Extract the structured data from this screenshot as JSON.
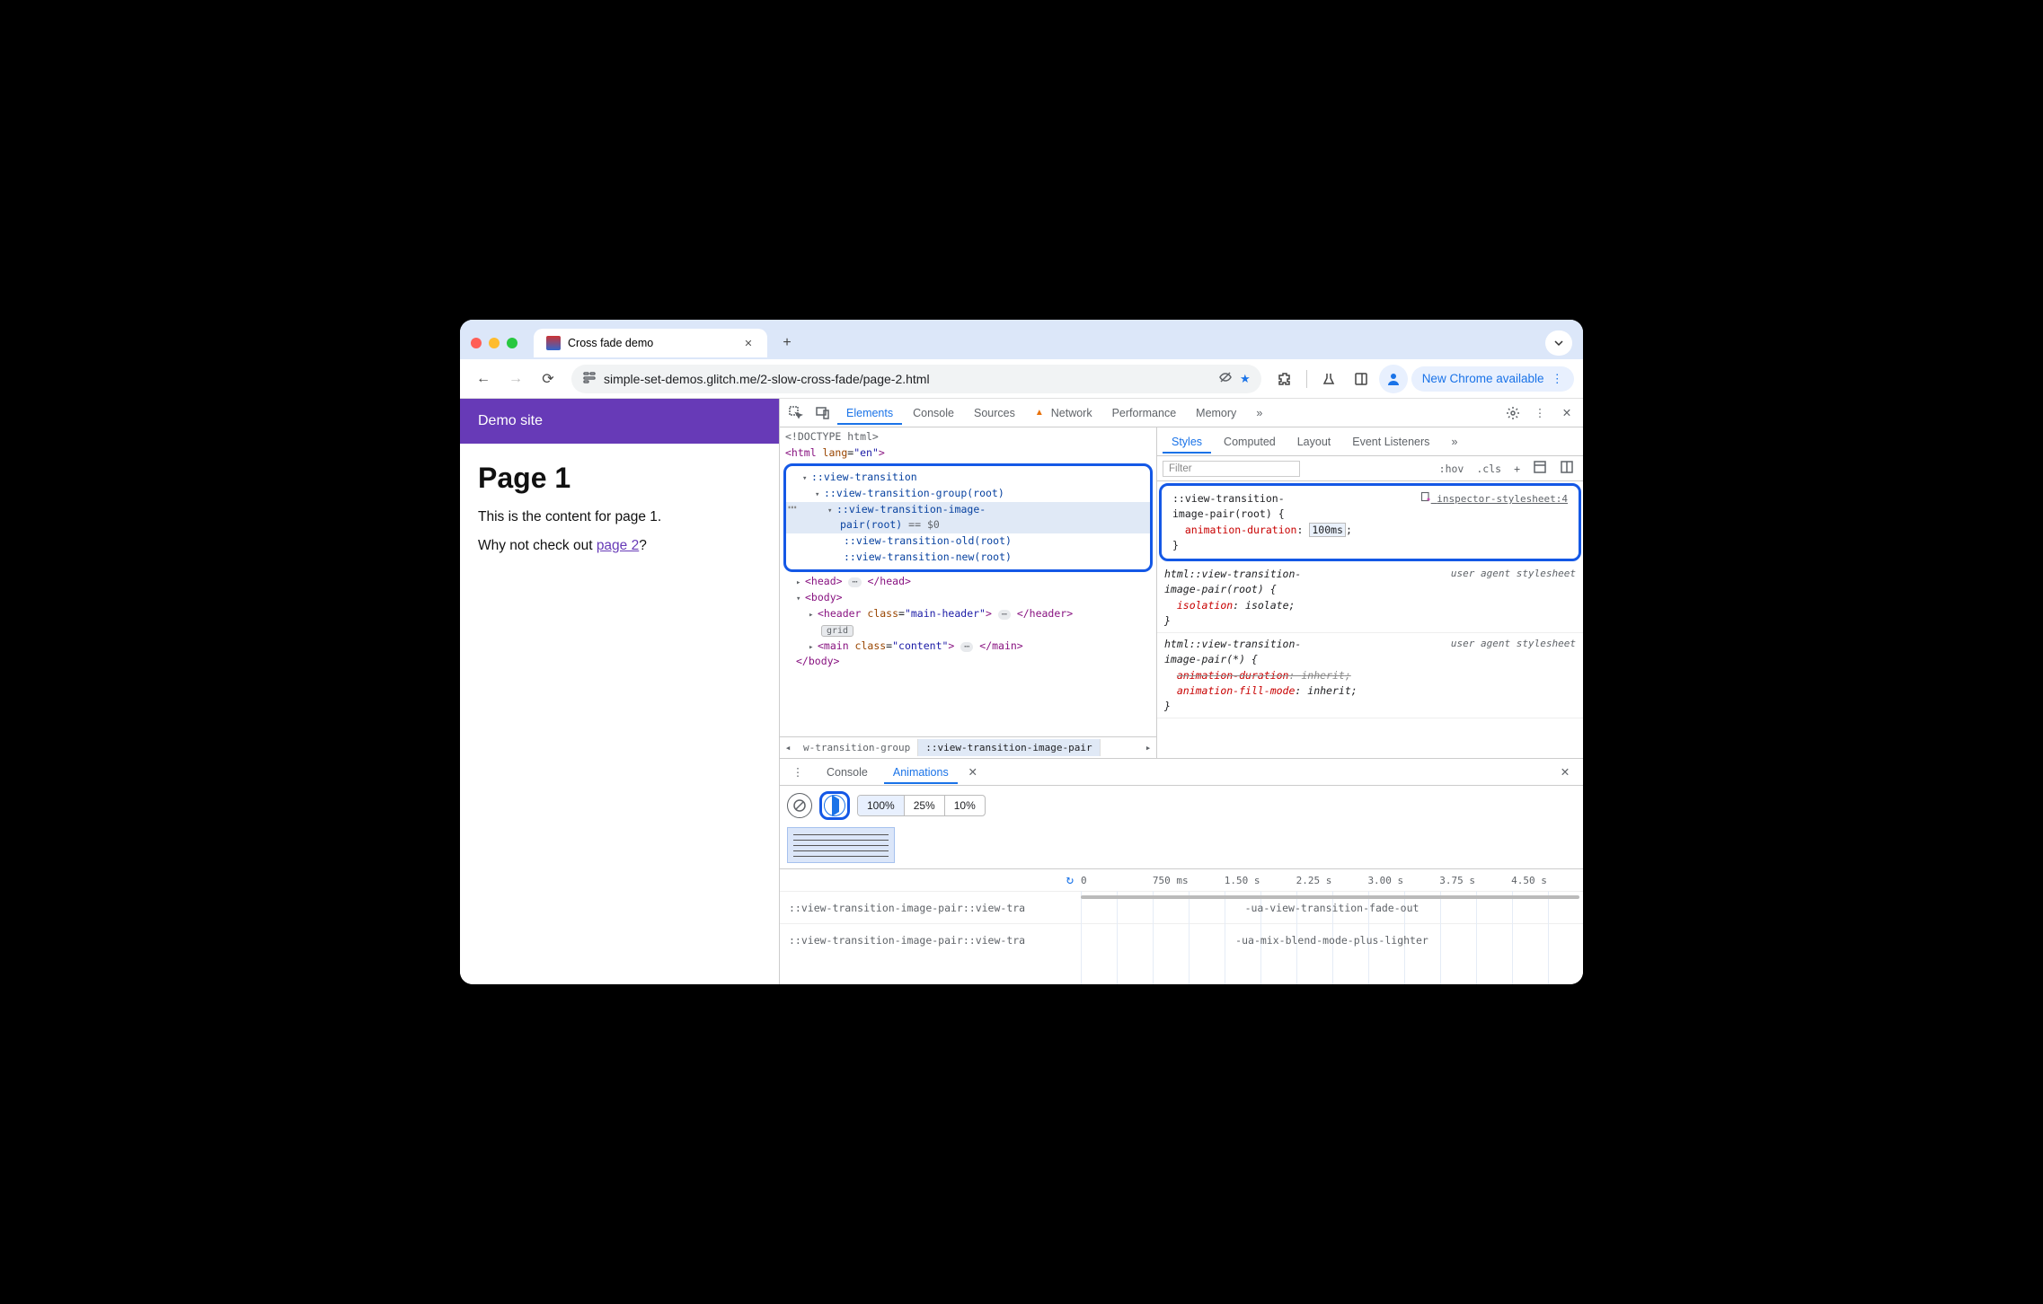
{
  "browser": {
    "tab_title": "Cross fade demo",
    "url": "simple-set-demos.glitch.me/2-slow-cross-fade/page-2.html",
    "update_label": "New Chrome available"
  },
  "page": {
    "site_title": "Demo site",
    "heading": "Page 1",
    "paragraph1": "This is the content for page 1.",
    "paragraph2_prefix": "Why not check out ",
    "paragraph2_link": "page 2",
    "paragraph2_suffix": "?"
  },
  "devtools": {
    "main_tabs": {
      "elements": "Elements",
      "console": "Console",
      "sources": "Sources",
      "network": "Network",
      "performance": "Performance",
      "memory": "Memory",
      "more": "»"
    },
    "dom": {
      "doctype": "<!DOCTYPE html>",
      "html_open": "<html lang=\"en\">",
      "vt": "::view-transition",
      "vt_group": "::view-transition-group(root)",
      "vt_pair_1": "::view-transition-image-",
      "vt_pair_2": "pair(root)",
      "dollar": " == $0",
      "vt_old": "::view-transition-old(root)",
      "vt_new": "::view-transition-new(root)",
      "head_open": "<head>",
      "head_close": "</head>",
      "body_open": "<body>",
      "header_open": "<header class=\"main-header\">",
      "header_close": "</header>",
      "grid_badge": "grid",
      "main_open": "<main class=\"content\">",
      "main_close": "</main>",
      "body_close": "</body>"
    },
    "breadcrumb": {
      "prev": "w-transition-group",
      "current": "::view-transition-image-pair"
    },
    "styles": {
      "tabs": {
        "styles": "Styles",
        "computed": "Computed",
        "layout": "Layout",
        "listeners": "Event Listeners",
        "more": "»"
      },
      "filter_placeholder": "Filter",
      "tools": {
        "hov": ":hov",
        "cls": ".cls"
      },
      "rule1": {
        "selector_l1": "::view-transition-",
        "selector_l2": "image-pair(root) {",
        "origin": "inspector-stylesheet:4",
        "prop": "animation-duration",
        "val": "100ms",
        "close": "}"
      },
      "rule2": {
        "selector_l1": "html::view-transition-",
        "selector_l2": "image-pair(root) {",
        "origin": "user agent stylesheet",
        "prop": "isolation",
        "val": "isolate",
        "close": "}"
      },
      "rule3": {
        "selector_l1": "html::view-transition-",
        "selector_l2": "image-pair(*) {",
        "origin": "user agent stylesheet",
        "prop1": "animation-duration",
        "val1": "inherit",
        "prop2": "animation-fill-mode",
        "val2": "inherit",
        "close": "}"
      }
    },
    "drawer": {
      "tabs": {
        "console": "Console",
        "animations": "Animations"
      },
      "speeds": {
        "s100": "100%",
        "s25": "25%",
        "s10": "10%"
      },
      "ruler": [
        "0",
        "750 ms",
        "1.50 s",
        "2.25 s",
        "3.00 s",
        "3.75 s",
        "4.50 s"
      ],
      "row1_label": "::view-transition-image-pair::view-tra",
      "row1_anim": "-ua-view-transition-fade-out",
      "row2_label": "::view-transition-image-pair::view-tra",
      "row2_anim": "-ua-mix-blend-mode-plus-lighter"
    }
  }
}
